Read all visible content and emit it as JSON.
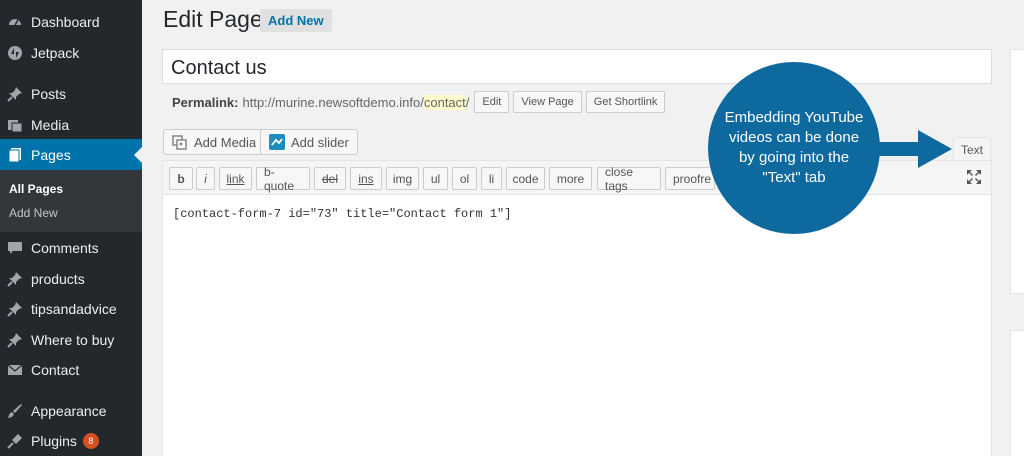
{
  "sidebar": {
    "items": [
      {
        "label": "Dashboard",
        "icon": "dashboard-icon"
      },
      {
        "label": "Jetpack",
        "icon": "jetpack-icon"
      },
      {
        "label": "Posts",
        "icon": "pin-icon"
      },
      {
        "label": "Media",
        "icon": "media-icon"
      },
      {
        "label": "Pages",
        "icon": "pages-icon",
        "active": true
      },
      {
        "label": "Comments",
        "icon": "comment-icon"
      },
      {
        "label": "products",
        "icon": "pin-icon"
      },
      {
        "label": "tipsandadvice",
        "icon": "pin-icon"
      },
      {
        "label": "Where to buy",
        "icon": "pin-icon"
      },
      {
        "label": "Contact",
        "icon": "mail-icon"
      },
      {
        "label": "Appearance",
        "icon": "brush-icon"
      },
      {
        "label": "Plugins",
        "icon": "plug-icon",
        "badge": "8"
      }
    ],
    "submenu": [
      "All Pages",
      "Add New"
    ]
  },
  "header": {
    "title": "Edit Page",
    "add_new": "Add New"
  },
  "title_field": {
    "value": "Contact us"
  },
  "permalink": {
    "label": "Permalink:",
    "url_prefix": "http://murine.newsoftdemo.info/",
    "slug": "contact",
    "suffix": "/",
    "buttons": [
      "Edit",
      "View Page",
      "Get Shortlink"
    ]
  },
  "media_buttons": {
    "add_media": "Add Media",
    "add_slider": "Add slider"
  },
  "editor": {
    "tab_text": "Text",
    "quicktags": [
      "b",
      "i",
      "link",
      "b-quote",
      "del",
      "ins",
      "img",
      "ul",
      "ol",
      "li",
      "code",
      "more",
      "close tags",
      "proofre"
    ],
    "content": "[contact-form-7 id=\"73\" title=\"Contact form 1\"]"
  },
  "callout": {
    "text": "Embedding YouTube videos can be done by going into the \"Text\" tab"
  },
  "colors": {
    "sidebar_bg": "#23282d",
    "accent": "#0073aa",
    "callout": "#0e6a9e",
    "badge": "#d54e21"
  }
}
